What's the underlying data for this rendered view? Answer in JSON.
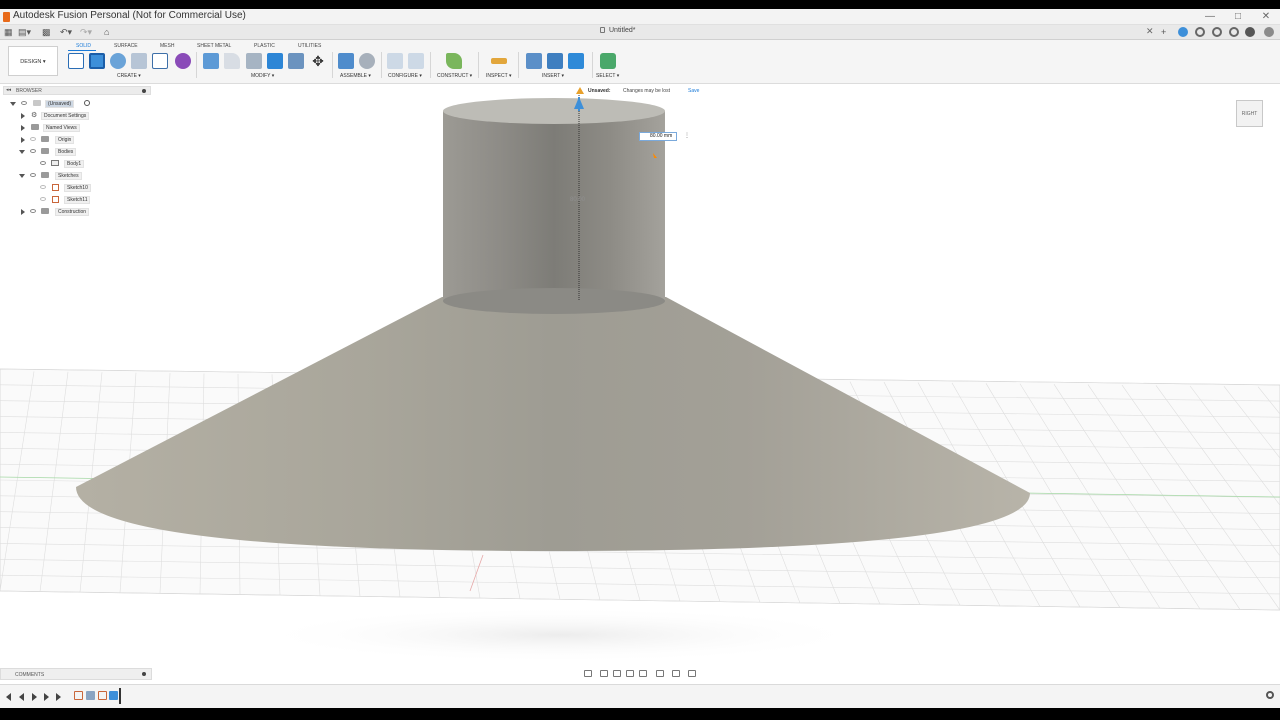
{
  "window": {
    "title": "Autodesk Fusion Personal (Not for Commercial Use)"
  },
  "document": {
    "tab_title": "Untitled*"
  },
  "toolbar": {
    "workspace": "DESIGN",
    "tabs": [
      "SOLID",
      "SURFACE",
      "MESH",
      "SHEET METAL",
      "PLASTIC",
      "UTILITIES"
    ],
    "active_tab": "SOLID",
    "groups": [
      "CREATE",
      "MODIFY",
      "ASSEMBLE",
      "CONFIGURE",
      "CONSTRUCT",
      "INSPECT",
      "INSERT",
      "SELECT"
    ]
  },
  "browser": {
    "title": "BROWSER",
    "items": [
      {
        "label": "(Unsaved)"
      },
      {
        "label": "Document Settings"
      },
      {
        "label": "Named Views"
      },
      {
        "label": "Origin"
      },
      {
        "label": "Bodies"
      },
      {
        "label": "Body1"
      },
      {
        "label": "Sketches"
      },
      {
        "label": "Sketch10"
      },
      {
        "label": "Sketch11"
      },
      {
        "label": "Construction"
      }
    ]
  },
  "notice": {
    "label": "Unsaved:",
    "message": "Changes may be lost",
    "action": "Save"
  },
  "dimension": {
    "input_value": "80.00 mm",
    "label": "80.00"
  },
  "viewcube": {
    "face": "RIGHT"
  },
  "comments": {
    "title": "COMMENTS"
  },
  "colors": {
    "accent": "#1a7ad8",
    "body": "#a3a29a",
    "grid": "#d8d8d8"
  }
}
